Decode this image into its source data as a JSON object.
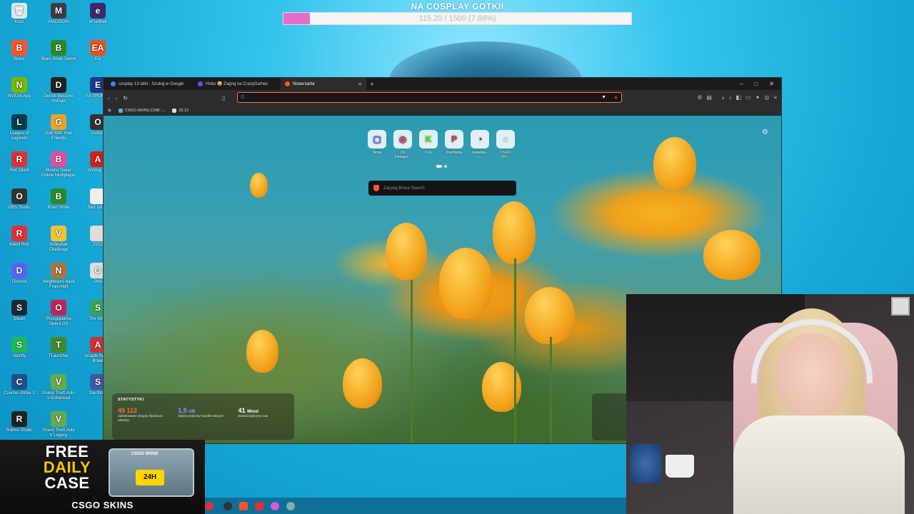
{
  "desktop_icons": [
    {
      "label": "Kosz",
      "color": "#d9e9f5",
      "glyph": "🗑"
    },
    {
      "label": "MADISON",
      "color": "#3c3c46",
      "glyph": "M"
    },
    {
      "label": "eFootball",
      "color": "#3a2b6c",
      "glyph": "e"
    },
    {
      "label": "Brave",
      "color": "#fb542b",
      "glyph": "B"
    },
    {
      "label": "Brain Show Demo",
      "color": "#2a8a2a",
      "glyph": "B"
    },
    {
      "label": "EA",
      "color": "#e8521f",
      "glyph": "EA"
    },
    {
      "label": "NVIDIA App",
      "color": "#76b900",
      "glyph": "N"
    },
    {
      "label": "Detroit Become Human",
      "color": "#222",
      "glyph": "D"
    },
    {
      "label": "EA SPORTS",
      "color": "#1b3a8a",
      "glyph": "E"
    },
    {
      "label": "League of Legends",
      "color": "#0a3b4b",
      "glyph": "L"
    },
    {
      "label": "Golf With Your Friends",
      "color": "#e8a32a",
      "glyph": "G"
    },
    {
      "label": "Outlast",
      "color": "#333",
      "glyph": "O"
    },
    {
      "label": "Riot Client",
      "color": "#e0303a",
      "glyph": "R"
    },
    {
      "label": "Bloons Tower Online Multiplayer",
      "color": "#e04fa0",
      "glyph": "B"
    },
    {
      "label": "Among Us",
      "color": "#c22",
      "glyph": "A"
    },
    {
      "label": "OBS Studio",
      "color": "#333",
      "glyph": "O"
    },
    {
      "label": "Brain Show",
      "color": "#2a8a2a",
      "glyph": "B"
    },
    {
      "label": "Bez tytułu",
      "color": "#eee",
      "glyph": ""
    },
    {
      "label": "Klient Riot",
      "color": "#e0303a",
      "glyph": "R"
    },
    {
      "label": "Volleyball Challenge",
      "color": "#f1c232",
      "glyph": "V"
    },
    {
      "label": "2222",
      "color": "#ddd",
      "glyph": ""
    },
    {
      "label": "Discord",
      "color": "#5865f2",
      "glyph": "D"
    },
    {
      "label": "Neighbours back From Hell",
      "color": "#a8763e",
      "glyph": "N"
    },
    {
      "label": "Ohio",
      "color": "#ddd",
      "glyph": "O"
    },
    {
      "label": "Steam",
      "color": "#1b2838",
      "glyph": "S"
    },
    {
      "label": "Przeglądarka Opera GX",
      "color": "#c0255a",
      "glyph": "O"
    },
    {
      "label": "The Sims",
      "color": "#3aa25a",
      "glyph": "S"
    },
    {
      "label": "Spotify",
      "color": "#1db954",
      "glyph": "S"
    },
    {
      "label": "TLauncher",
      "color": "#3f8a2a",
      "glyph": "T"
    },
    {
      "label": "Arcade Space Brawl",
      "color": "#c33",
      "glyph": "A"
    },
    {
      "label": "Counter-Strike 2",
      "color": "#1f4f8a",
      "glyph": "C"
    },
    {
      "label": "Grand Theft Auto V Enhanced",
      "color": "#6aa84f",
      "glyph": "V"
    },
    {
      "label": "StarSto...",
      "color": "#3c5aa6",
      "glyph": "S"
    },
    {
      "label": "Roblox Studio",
      "color": "#222",
      "glyph": "R"
    },
    {
      "label": "Grand Theft Auto V Legacy",
      "color": "#6aa84f",
      "glyph": "V"
    }
  ],
  "goal": {
    "title": "NA COSPLAY GOTKII",
    "text": "115.20 / 1500 (7.68%)",
    "progress_fraction": 0.0768,
    "fill_color": "#e46fc9"
  },
  "browser": {
    "tabs": [
      {
        "title": "cosplay 13 latki - Szukaj w Google",
        "favicon_color": "#4285f4",
        "active": false
      },
      {
        "title": "Hobo 😀 Zagraj na CrazyGames",
        "favicon_color": "#6a4cff",
        "active": false
      },
      {
        "title": "Nowa karta",
        "favicon_color": "#fb542b",
        "active": true
      }
    ],
    "new_tab_glyph": "+",
    "window_controls": [
      "–",
      "□",
      "✕"
    ],
    "nav_icons": [
      "back-icon",
      "forward-icon",
      "reload-icon",
      "bookmark-icon"
    ],
    "url_value": "",
    "bookmarks": [
      {
        "label": "CSGO-SKINS.COM -..."
      },
      {
        "label": "22.12"
      }
    ],
    "ntp": {
      "tiles": [
        {
          "label": "Stripe",
          "glyph": "▢",
          "color": "#635bff"
        },
        {
          "label": "(3) Instagra...",
          "glyph": "◎",
          "color": "#e1306c"
        },
        {
          "label": "Kick",
          "glyph": "K",
          "color": "#53fc18"
        },
        {
          "label": "PayMedia",
          "glyph": "P",
          "color": "#e0303a"
        },
        {
          "label": "zadanka - I...",
          "glyph": "◔",
          "color": "#333"
        },
        {
          "label": "CSGO-SKI...",
          "glyph": "◌",
          "color": "#8fcbe0"
        }
      ],
      "search_placeholder": "Zapytaj Brave Search",
      "stats": {
        "title": "STATYSTYKI",
        "items": [
          {
            "value": "49 112",
            "unit": "",
            "label": "Zablokowane skrypty śledzące i reklamy",
            "color": "#ff6a3d"
          },
          {
            "value": "1,5",
            "unit": "GB",
            "label": "Zaoszczędzony transfer danych",
            "color": "#a88bff"
          },
          {
            "value": "41",
            "unit": "Minut",
            "label": "Zaoszczędzony czas",
            "color": "#ffffff"
          }
        ]
      }
    }
  },
  "banner": {
    "free": "FREE",
    "daily": "DAILY",
    "case": "CASE",
    "case_label": "24H",
    "case_brand": "CSGO SKINS",
    "brand": "CSGO SKINS"
  }
}
